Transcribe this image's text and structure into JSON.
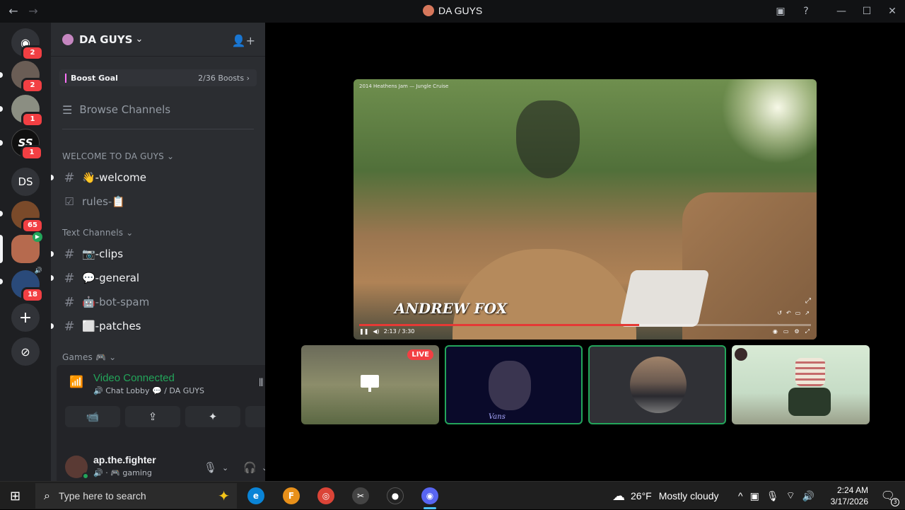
{
  "titlebar": {
    "title": "DA GUYS",
    "back_icon": "←",
    "forward_icon": "→",
    "inbox_icon": "▣",
    "help_icon": "?",
    "minimize_icon": "—",
    "maximize_icon": "☐",
    "close_icon": "✕"
  },
  "guilds": {
    "home_badge": "2",
    "items": [
      {
        "badge": "2"
      },
      {
        "badge": "1"
      },
      {
        "label": "SS",
        "badge": "1"
      },
      {
        "label": "DS"
      },
      {
        "badge": "65"
      },
      {
        "badge": ""
      },
      {
        "badge": "18"
      }
    ],
    "add_icon": "+",
    "discover_icon": "⊘"
  },
  "server": {
    "name": "DA GUYS",
    "chevron": "⌄",
    "invite_icon": "👤+",
    "boost_label": "Boost Goal",
    "boost_count": "2/36 Boosts ›",
    "browse": "Browse Channels",
    "categories": {
      "welcome": "WELCOME TO DA GUYS ⌄",
      "text": "Text Channels ⌄",
      "games": "Games 🎮 ⌄"
    },
    "channels": [
      {
        "icon": "#",
        "name": "👋-welcome",
        "unread": true
      },
      {
        "icon": "☑",
        "name": "rules-📋",
        "unread": false
      },
      {
        "icon": "#",
        "name": "📷-clips",
        "unread": true
      },
      {
        "icon": "#",
        "name": "💬-general",
        "unread": true
      },
      {
        "icon": "#",
        "name": "🤖-bot-spam",
        "unread": false
      },
      {
        "icon": "#",
        "name": "⬜-patches",
        "unread": true
      }
    ]
  },
  "voice": {
    "status": "Video Connected",
    "location": "🔊 Chat Lobby 💬 / DA GUYS",
    "buttons": [
      "📹",
      "⇪",
      "✦",
      "✺"
    ]
  },
  "user": {
    "name": "ap.the.fighter",
    "status": "🔊 · 🎮 gaming",
    "mic_icon": "🎙",
    "headset_icon": "🎧",
    "settings_icon": "⚙",
    "chevron": "⌄"
  },
  "stream": {
    "top_caption": "2014 Heathens Jam — Jungle Cruise",
    "overlay_name": "ANDREW FOX",
    "time": "2:13 / 3:30",
    "progress": 0.62,
    "live_label": "LIVE",
    "signature": "Vans"
  },
  "taskbar": {
    "start_icon": "⊞",
    "search_placeholder": "Type here to search",
    "search_icon": "⌕",
    "sparkle_icon": "✦",
    "weather_temp": "26°F",
    "weather_text": "Mostly cloudy",
    "tray_chevron": "^",
    "time": "2:24 AM",
    "date": "3/17/2026",
    "notif_count": "3"
  },
  "colors": {
    "accent_green": "#23a55a",
    "badge_red": "#f23f43",
    "sidebar_bg": "#2b2d31",
    "guild_bg": "#1e1f22"
  }
}
